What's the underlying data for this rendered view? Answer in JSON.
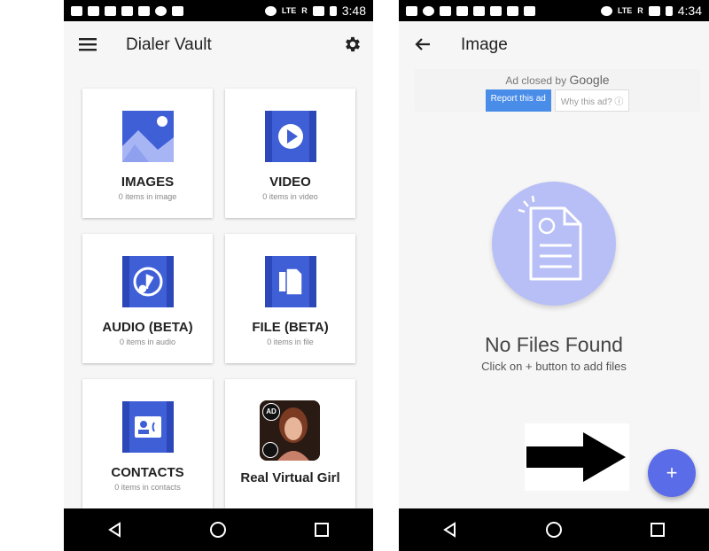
{
  "left_screen": {
    "status_bar": {
      "time": "3:48",
      "network": "LTE",
      "roaming": "R"
    },
    "app_bar": {
      "title": "Dialer Vault",
      "menu_icon": "hamburger-menu-icon",
      "settings_icon": "gear-icon"
    },
    "tiles": [
      {
        "label": "IMAGES",
        "sub": "0 items in image",
        "icon": "image-icon"
      },
      {
        "label": "VIDEO",
        "sub": "0 items in video",
        "icon": "video-play-icon"
      },
      {
        "label": "AUDIO (BETA)",
        "sub": "0 items in audio",
        "icon": "music-note-icon"
      },
      {
        "label": "FILE (BETA)",
        "sub": "0 items in file",
        "icon": "file-copy-icon"
      },
      {
        "label": "CONTACTS",
        "sub": "0 items in contacts",
        "icon": "contact-card-icon"
      },
      {
        "label": "Real Virtual Girl",
        "badge": "AD",
        "icon": "ad-app-icon"
      }
    ]
  },
  "right_screen": {
    "status_bar": {
      "time": "4:34",
      "network": "LTE",
      "roaming": "R"
    },
    "app_bar": {
      "title": "Image",
      "back_icon": "back-arrow-icon"
    },
    "ad": {
      "closed_text": "Ad closed by",
      "google": "Google",
      "report": "Report this ad",
      "why": "Why this ad? ⓘ"
    },
    "empty_state": {
      "title": "No Files Found",
      "subtitle": "Click on + button to add files"
    },
    "fab": {
      "label": "+"
    }
  },
  "colors": {
    "accent": "#3f5fd6",
    "fab": "#5b6ce8",
    "empty_circle": "#b7bff6",
    "ad_button": "#4a8de8"
  }
}
